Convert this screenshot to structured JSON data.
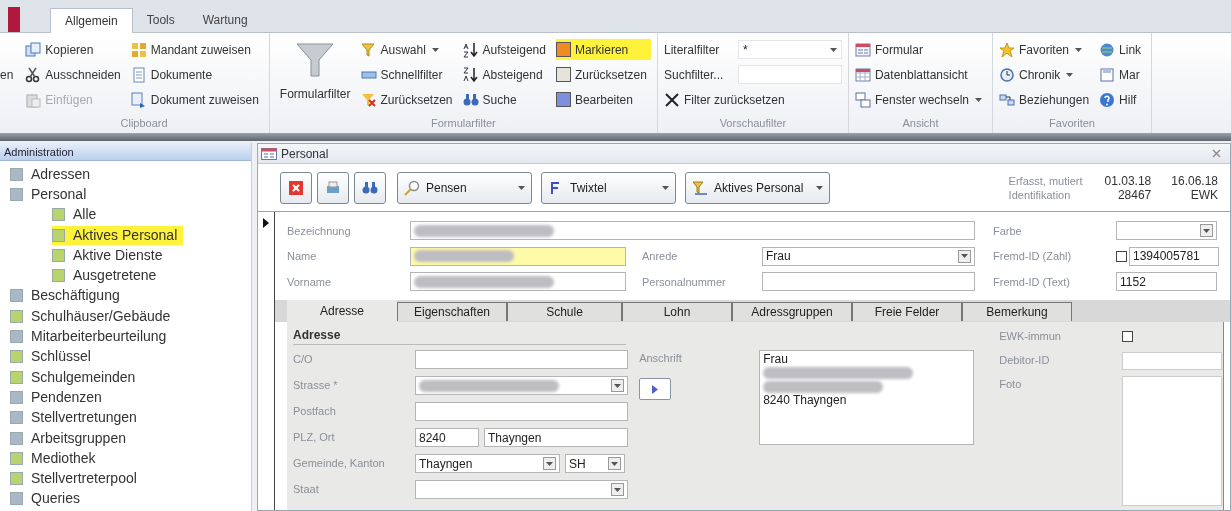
{
  "ribbon": {
    "tabs": [
      {
        "label": "Allgemein",
        "selected": true
      },
      {
        "label": "Tools",
        "selected": false
      },
      {
        "label": "Wartung",
        "selected": false
      }
    ],
    "groups": [
      {
        "columns": [
          [
            {
              "label": "en",
              "kind": "cut",
              "disabled": false,
              "highlighted": false
            }
          ]
        ]
      },
      {
        "title": "Clipboard",
        "columns": [
          [
            {
              "label": "Kopieren",
              "kind": "button",
              "disabled": false,
              "highlighted": false
            },
            {
              "label": "Ausschneiden",
              "kind": "button",
              "disabled": false,
              "highlighted": false
            },
            {
              "label": "Einfügen",
              "kind": "button",
              "disabled": true,
              "highlighted": false
            }
          ],
          [
            {
              "label": "Mandant zuweisen",
              "kind": "button",
              "disabled": false,
              "highlighted": false
            },
            {
              "label": "Dokumente",
              "kind": "button",
              "disabled": false,
              "highlighted": false
            },
            {
              "label": "Dokument zuweisen",
              "kind": "button",
              "disabled": false,
              "highlighted": false
            }
          ]
        ]
      },
      {
        "title": "Formularfilter",
        "columns": [
          [
            {
              "label": "Formularfilter",
              "kind": "large",
              "disabled": false,
              "highlighted": false
            }
          ],
          [
            {
              "label": "Auswahl",
              "kind": "menu",
              "disabled": false,
              "highlighted": false
            },
            {
              "label": "Schnellfilter",
              "kind": "button",
              "disabled": false,
              "highlighted": false
            },
            {
              "label": "Zurücksetzen",
              "kind": "button",
              "disabled": false,
              "highlighted": false
            }
          ],
          [
            {
              "label": "Aufsteigend",
              "kind": "button",
              "disabled": false,
              "highlighted": false
            },
            {
              "label": "Absteigend",
              "kind": "button",
              "disabled": false,
              "highlighted": false
            },
            {
              "label": "Suche",
              "kind": "button",
              "disabled": false,
              "highlighted": false
            }
          ],
          [
            {
              "label": "Markieren",
              "kind": "swatch",
              "color": "#f08a24",
              "disabled": false,
              "highlighted": true
            },
            {
              "label": "Zurücksetzen",
              "kind": "swatch",
              "color": "#e4e4dc",
              "disabled": false,
              "highlighted": false
            },
            {
              "label": "Bearbeiten",
              "kind": "swatch",
              "color": "#7f8fe0",
              "disabled": false,
              "highlighted": false
            }
          ]
        ]
      },
      {
        "title": "Vorschaufilter",
        "columns": [
          [
            {
              "label": "Literalfilter",
              "kind": "combo",
              "value": "*",
              "disabled": false,
              "highlighted": false
            },
            {
              "label": "Suchfilter...",
              "kind": "field",
              "disabled": false,
              "highlighted": false
            },
            {
              "label": "Filter zurücksetzen",
              "kind": "button",
              "disabled": false,
              "highlighted": false
            }
          ]
        ]
      },
      {
        "title": "Ansicht",
        "columns": [
          [
            {
              "label": "Formular",
              "kind": "button",
              "disabled": false,
              "highlighted": false
            },
            {
              "label": "Datenblattansicht",
              "kind": "button",
              "disabled": false,
              "highlighted": false
            },
            {
              "label": "Fenster wechseln",
              "kind": "menu",
              "disabled": false,
              "highlighted": false
            }
          ]
        ]
      },
      {
        "title": "Favoriten",
        "columns": [
          [
            {
              "label": "Favoriten",
              "kind": "menu",
              "disabled": false,
              "highlighted": false
            },
            {
              "label": "Chronik",
              "kind": "menu",
              "disabled": false,
              "highlighted": false
            },
            {
              "label": "Beziehungen",
              "kind": "button",
              "disabled": false,
              "highlighted": false
            }
          ],
          [
            {
              "label": "Link",
              "kind": "button",
              "disabled": false,
              "highlighted": false
            },
            {
              "label": "Mar",
              "kind": "button",
              "disabled": false,
              "highlighted": false
            },
            {
              "label": "Hilf",
              "kind": "button",
              "disabled": false,
              "highlighted": false
            }
          ]
        ]
      }
    ]
  },
  "sidebar": {
    "title": "Administration",
    "items": [
      {
        "label": "Adressen",
        "color": "#aab7c6",
        "selected": false
      },
      {
        "label": "Personal",
        "color": "#aab7c6",
        "selected": false,
        "children": [
          {
            "label": "Alle",
            "color": "#b9d46c",
            "selected": false
          },
          {
            "label": "Aktives Personal",
            "color": "#b9d46c",
            "selected": true
          },
          {
            "label": "Aktive Dienste",
            "color": "#b9d46c",
            "selected": false
          },
          {
            "label": "Ausgetretene",
            "color": "#b9d46c",
            "selected": false
          }
        ]
      },
      {
        "label": "Beschäftigung",
        "color": "#aab7c6",
        "selected": false
      },
      {
        "label": "Schulhäuser/Gebäude",
        "color": "#b9d46c",
        "selected": false
      },
      {
        "label": "Mitarbeiterbeurteilung",
        "color": "#aab7c6",
        "selected": false
      },
      {
        "label": "Schlüssel",
        "color": "#b9d46c",
        "selected": false
      },
      {
        "label": "Schulgemeinden",
        "color": "#b9d46c",
        "selected": false
      },
      {
        "label": "Pendenzen",
        "color": "#aab7c6",
        "selected": false
      },
      {
        "label": "Stellvertretungen",
        "color": "#aab7c6",
        "selected": false
      },
      {
        "label": "Arbeitsgruppen",
        "color": "#aab7c6",
        "selected": false
      },
      {
        "label": "Mediothek",
        "color": "#b9d46c",
        "selected": false
      },
      {
        "label": "Stellvertreterpool",
        "color": "#b9d46c",
        "selected": false
      },
      {
        "label": "Queries",
        "color": "#aab7c6",
        "selected": false
      }
    ]
  },
  "form": {
    "title": "Personal",
    "toolbar": {
      "combos": [
        {
          "label": "Pensen"
        },
        {
          "label": "Twixtel"
        },
        {
          "label": "Aktives Personal"
        }
      ]
    },
    "meta": [
      [
        "Erfasst, mutiert",
        "01.03.18",
        "16.06.18"
      ],
      [
        "Identifikation",
        "28467",
        "EWK"
      ]
    ],
    "fields": [
      {
        "label": "Bezeichnung",
        "kind": "text",
        "redacted": true,
        "focused": false
      },
      {
        "label": "Farbe",
        "kind": "combo",
        "redacted": false,
        "focused": false
      },
      {
        "label": "Name",
        "kind": "text",
        "redacted": true,
        "focused": true
      },
      {
        "label": "Anrede",
        "kind": "combo",
        "value": "Frau",
        "redacted": false,
        "focused": false
      },
      {
        "label": "Fremd-ID (Zahl)",
        "kind": "check-text",
        "checked": false,
        "value": "1394005781",
        "redacted": false,
        "focused": false
      },
      {
        "label": "Vorname",
        "kind": "text",
        "redacted": true,
        "focused": false
      },
      {
        "label": "Personalnummer",
        "kind": "text",
        "redacted": false,
        "focused": false
      },
      {
        "label": "Fremd-ID (Text)",
        "kind": "text",
        "value": "1152",
        "redacted": false,
        "focused": false
      }
    ],
    "tabs": [
      {
        "label": "Adresse",
        "selected": true
      },
      {
        "label": "Eigenschaften",
        "selected": false
      },
      {
        "label": "Schule",
        "selected": false
      },
      {
        "label": "Lohn",
        "selected": false
      },
      {
        "label": "Adressgruppen",
        "selected": false
      },
      {
        "label": "Freie Felder",
        "selected": false
      },
      {
        "label": "Bemerkung",
        "selected": false
      }
    ],
    "address": {
      "section": "Adresse",
      "rows": [
        {
          "label": "C/O",
          "inputs": [
            {
              "kind": "text",
              "redacted": false
            }
          ]
        },
        {
          "label": "Strasse *",
          "inputs": [
            {
              "kind": "combo",
              "redacted": true
            }
          ]
        },
        {
          "label": "Postfach",
          "inputs": [
            {
              "kind": "text",
              "redacted": false
            }
          ]
        },
        {
          "label": "PLZ, Ort",
          "inputs": [
            {
              "kind": "text",
              "value": "8240",
              "redacted": false
            },
            {
              "kind": "text",
              "value": "Thayngen",
              "redacted": false
            }
          ]
        },
        {
          "label": "Gemeinde, Kanton",
          "inputs": [
            {
              "kind": "combo",
              "value": "Thayngen",
              "redacted": false
            },
            {
              "kind": "combo",
              "value": "SH",
              "redacted": false
            }
          ]
        },
        {
          "label": "Staat",
          "inputs": [
            {
              "kind": "combo",
              "redacted": false
            }
          ]
        }
      ],
      "anschrift": {
        "label": "Anschrift",
        "lines": [
          {
            "text": "Frau",
            "redacted": false
          },
          {
            "redacted": true
          },
          {
            "redacted": true
          },
          {
            "text": "8240 Thayngen",
            "redacted": false
          }
        ]
      },
      "ewk_immun": {
        "label": "EWK-immun",
        "checked": false
      },
      "debitor": {
        "label": "Debitor-ID"
      },
      "foto": {
        "label": "Foto"
      }
    }
  }
}
